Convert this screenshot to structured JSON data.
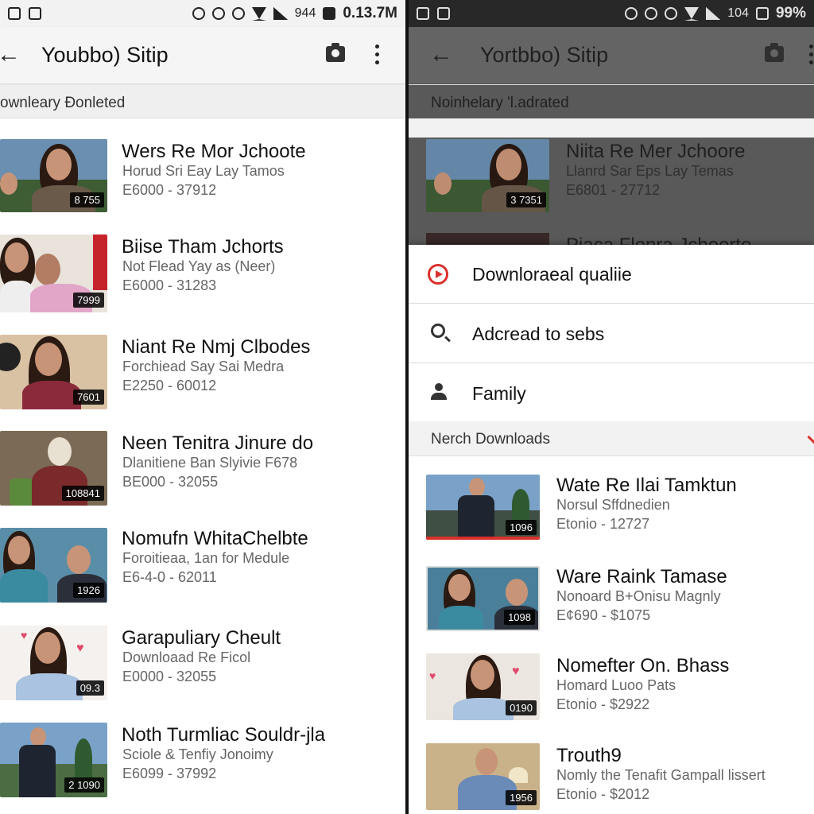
{
  "left": {
    "status": {
      "text": "944",
      "time": "0.13.7M"
    },
    "appbar": {
      "title": "Youbbo) Sitip"
    },
    "section": "ownleary Ɖonleted",
    "videos": [
      {
        "title": "Wers Re Mor Jchoote",
        "sub": "Horud Sri Eay Lay Tamos",
        "meta": "E6000 - 37912",
        "duration": "8 755"
      },
      {
        "title": "Biise Tham Jchorts",
        "sub": "Not Flead Yay as (Neer)",
        "meta": "E6000 - 31283",
        "duration": "7999"
      },
      {
        "title": "Niant Re Nmj Clbodes",
        "sub": "Forchiead Say Sai Medra",
        "meta": "E2250 - 60012",
        "duration": "7601"
      },
      {
        "title": "Neen Tenitra Jinure do",
        "sub": "Dlanitiene Ban Slyivie F678",
        "meta": "BE000 - 32055",
        "duration": "108841"
      },
      {
        "title": "Nomufn WhitaChelbte",
        "sub": "Foroitieaa, 1an for Medule",
        "meta": "E6-4-0 - 62011",
        "duration": "1926"
      },
      {
        "title": "Garapuliary Cheult",
        "sub": "Downloaad Re Ficol",
        "meta": "E0000 - 32055",
        "duration": "09.3"
      },
      {
        "title": "Noth Turmliac Souldr-jla",
        "sub": "Sciole & Tenfiy Jonoimy",
        "meta": "E6099 - 37992",
        "duration": "2 1090"
      }
    ]
  },
  "right": {
    "status": {
      "text": "104",
      "battery": "99%"
    },
    "appbar": {
      "title": "Yortbbo) Sitip"
    },
    "section": "Noinhelary 'l.adrated",
    "dim_videos": [
      {
        "title": "Niita Re Mer Jchoore",
        "sub": "Llanrd Sar Eps Lay Temas",
        "meta": "E6801 - 27712",
        "duration": "3 7351"
      },
      {
        "title": "Piaca Flonra Jchoorto"
      }
    ],
    "menu": [
      {
        "label": "Downloraeal qualiie",
        "icon": "play-circle-icon"
      },
      {
        "label": "Adcread to sebs",
        "icon": "search-icon"
      },
      {
        "label": "Family",
        "icon": "person-icon"
      }
    ],
    "downloads_header": "Nerch Downloads",
    "videos": [
      {
        "title": "Wate Re Ilai Tamktun",
        "sub": "Norsul Sffdnedien",
        "meta": "Etonio - 12727",
        "duration": "1096"
      },
      {
        "title": "Ware Raink Tamase",
        "sub": "Nonoard B+Onisu Magnly",
        "meta": "E¢690 - $1075",
        "duration": "1098"
      },
      {
        "title": "Nomefter On. Bhass",
        "sub": "Homard Luoo Pats",
        "meta": "Etonio - $2922",
        "duration": "0190"
      },
      {
        "title": "Trouth9",
        "sub": "Nomly the Tenafit Gampall lissert",
        "meta": "Etonio - $2012",
        "duration": "1956"
      }
    ]
  },
  "colors": {
    "accent": "#d9312b",
    "duration_bg": "#000000"
  }
}
